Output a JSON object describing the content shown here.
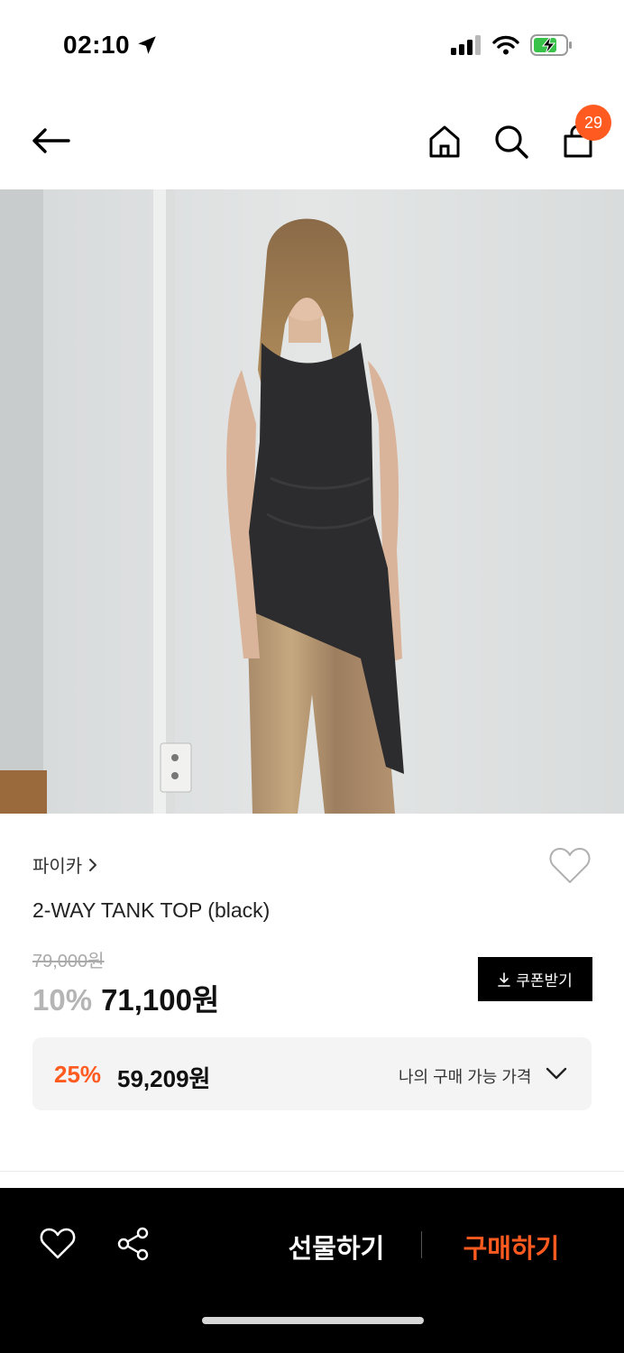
{
  "status": {
    "time": "02:10"
  },
  "header": {
    "cart_count": "29"
  },
  "product": {
    "brand": "파이카",
    "name": "2-WAY TANK TOP (black)",
    "original_price": "79,000원",
    "discount_rate": "10%",
    "sale_price": "71,100원",
    "coupon_label": "쿠폰받기",
    "my_price": {
      "rate": "25%",
      "price": "59,209원",
      "label": "나의 구매 가능 가격"
    }
  },
  "bottom_bar": {
    "gift_label": "선물하기",
    "buy_label": "구매하기"
  },
  "colors": {
    "accent": "#ff5a1f",
    "bottom_bar": "#000000"
  }
}
